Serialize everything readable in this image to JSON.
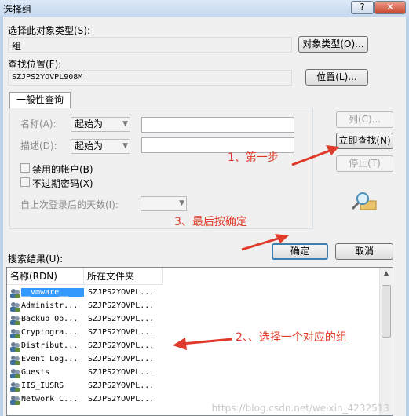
{
  "dialog": {
    "title": "选择组",
    "help_label": "?",
    "close_label": "✕"
  },
  "object_type": {
    "label": "选择此对象类型(S):",
    "value": "组",
    "button": "对象类型(O)..."
  },
  "location": {
    "label": "查找位置(F):",
    "value": "SZJPS2YOVPL908M",
    "button": "位置(L)..."
  },
  "common_queries": {
    "tab_label": "一般性查询",
    "name_label": "名称(A):",
    "name_mode": "起始为",
    "desc_label": "描述(D):",
    "desc_mode": "起始为",
    "disabled_accounts": "禁用的帐户(B)",
    "non_expiring_pw": "不过期密码(X)",
    "days_since_logon_label": "自上次登录后的天数(I):"
  },
  "side_buttons": {
    "columns": "列(C)...",
    "find_now": "立即查找(N)",
    "stop": "停止(T)"
  },
  "actions": {
    "ok": "确定",
    "cancel": "取消"
  },
  "annotations": {
    "step1": "1、第一步",
    "step2": "2、、选择一个对应的组",
    "step3": "3、最后按确定"
  },
  "results": {
    "label": "搜索结果(U):",
    "columns": [
      "名称(RDN)",
      "所在文件夹"
    ],
    "rows": [
      {
        "name": "__vmware__",
        "folder": "SZJPS2YOVPL..."
      },
      {
        "name": "Administr...",
        "folder": "SZJPS2YOVPL..."
      },
      {
        "name": "Backup Op...",
        "folder": "SZJPS2YOVPL..."
      },
      {
        "name": "Cryptogra...",
        "folder": "SZJPS2YOVPL..."
      },
      {
        "name": "Distribut...",
        "folder": "SZJPS2YOVPL..."
      },
      {
        "name": "Event Log...",
        "folder": "SZJPS2YOVPL..."
      },
      {
        "name": "Guests",
        "folder": "SZJPS2YOVPL..."
      },
      {
        "name": "IIS_IUSRS",
        "folder": "SZJPS2YOVPL..."
      },
      {
        "name": "Network C...",
        "folder": "SZJPS2YOVPL..."
      }
    ],
    "selected_index": 0
  },
  "watermark": "https://blog.csdn.net/weixin_4232513"
}
